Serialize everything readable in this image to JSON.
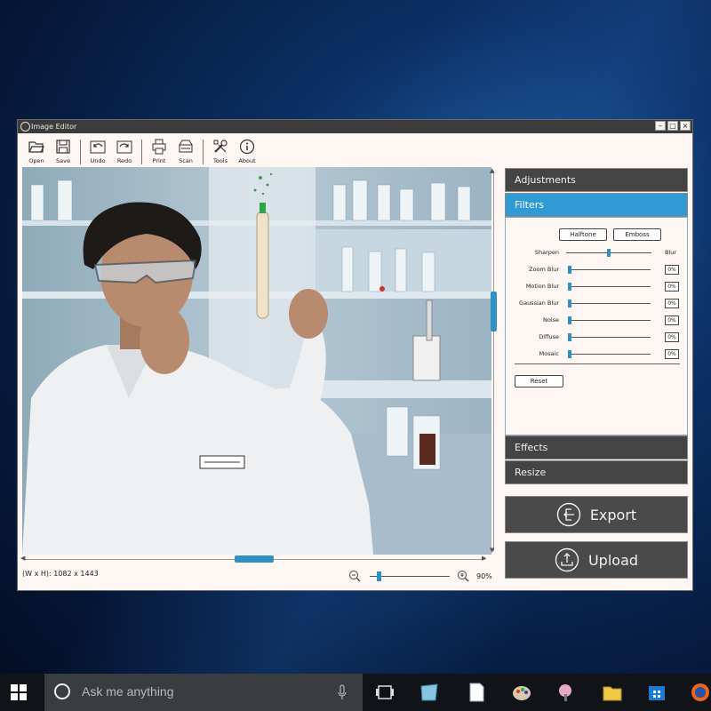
{
  "window": {
    "title": "Image Editor",
    "controls": [
      "–",
      "□",
      "×"
    ]
  },
  "toolbar": {
    "items": [
      {
        "label": "Open",
        "icon": "folder-open-icon"
      },
      {
        "label": "Save",
        "icon": "save-icon"
      },
      {
        "label": "Undo",
        "icon": "undo-icon"
      },
      {
        "label": "Redo",
        "icon": "redo-icon"
      },
      {
        "label": "Print",
        "icon": "printer-icon"
      },
      {
        "label": "Scan",
        "icon": "scanner-icon"
      },
      {
        "label": "Tools",
        "icon": "tools-icon"
      },
      {
        "label": "About",
        "icon": "info-icon"
      }
    ]
  },
  "canvas": {
    "dimensions_text": "(W x H): 1082 x 1443",
    "zoom": "90%"
  },
  "panel": {
    "adjustments": "Adjustments",
    "filters": "Filters",
    "effects": "Effects",
    "resize": "Resize",
    "halftone": "Halftone",
    "emboss": "Emboss",
    "sharpen": "Sharpen",
    "blur": "Blur",
    "sharpen_blur_position": 0.5,
    "sliders": [
      {
        "label": "Zoom Blur",
        "value": "0%"
      },
      {
        "label": "Motion Blur",
        "value": "0%"
      },
      {
        "label": "Gaussian Blur",
        "value": "0%"
      },
      {
        "label": "Noise",
        "value": "0%"
      },
      {
        "label": "Diffuse",
        "value": "0%"
      },
      {
        "label": "Mosaic",
        "value": "0%"
      }
    ],
    "reset": "Reset"
  },
  "actions": {
    "export": "Export",
    "upload": "Upload"
  },
  "taskbar": {
    "search_placeholder": "Ask me anything"
  },
  "colors": {
    "accent": "#2f9ad3",
    "panel_dark": "#444444",
    "window_bg": "#fdf6f2"
  }
}
